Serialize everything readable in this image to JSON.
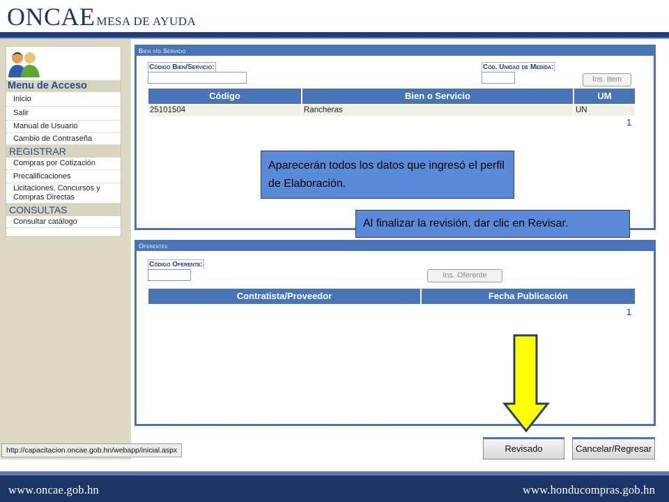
{
  "header": {
    "brand_main": "ONCAE",
    "brand_sub": "MESA DE AYUDA"
  },
  "sidebar": {
    "title": "Menu de Acceso",
    "items_general": [
      {
        "label": "Inicio"
      },
      {
        "label": "Salir"
      },
      {
        "label": "Manual de Usuario"
      },
      {
        "label": "Cambio de Contraseña"
      }
    ],
    "registrar": {
      "heading": "REGISTRAR",
      "items": [
        {
          "label": "Compras por Cotización"
        },
        {
          "label": "Precalificaciones"
        },
        {
          "label": "Licitaciones, Concursos y Compras Directas"
        }
      ]
    },
    "consultas": {
      "heading": "CONSULTAS",
      "items": [
        {
          "label": "Consultar catálogo"
        }
      ]
    }
  },
  "bien_servicio": {
    "section_title": "Bien y/o Servicio",
    "codigo_label": "Código Bien/Servicio:",
    "codigo_value": "",
    "unidad_label": "Cód. Unidad de Medida:",
    "unidad_value": "",
    "insert_button": "Ins. Item",
    "columns": [
      "Código",
      "Bien o Servicio",
      "UM"
    ],
    "rows": [
      {
        "codigo": "25101504",
        "bien": "Rancheras",
        "um": "UN"
      }
    ],
    "page": "1"
  },
  "oferentes": {
    "section_title": "Oferentes",
    "codigo_label": "Código Oferente:",
    "codigo_value": "",
    "insert_button": "Ins. Oferente",
    "columns": [
      "Contratista/Proveedor",
      "Fecha Publicación"
    ],
    "page": "1"
  },
  "callouts": {
    "data_note": "Aparecerán todos los datos que ingresó el perfil de Elaboración.",
    "review_note": "Al finalizar la revisión, dar clic en Revisar."
  },
  "actions": {
    "revisado": "Revisado",
    "cancelar": "Cancelar/Regresar"
  },
  "status_bar": {
    "url": "http://capacitacion.oncae.gob.hn/webapp/inicial.aspx"
  },
  "footer": {
    "left_link": "www.oncae.gob.hn",
    "right_link": "www.honducompras.gob.hn"
  },
  "colors": {
    "brand_navy": "#1c3566",
    "accent_blue": "#4a74b6",
    "callout_blue": "#5b8bd8",
    "arrow_yellow": "#ffff00"
  }
}
